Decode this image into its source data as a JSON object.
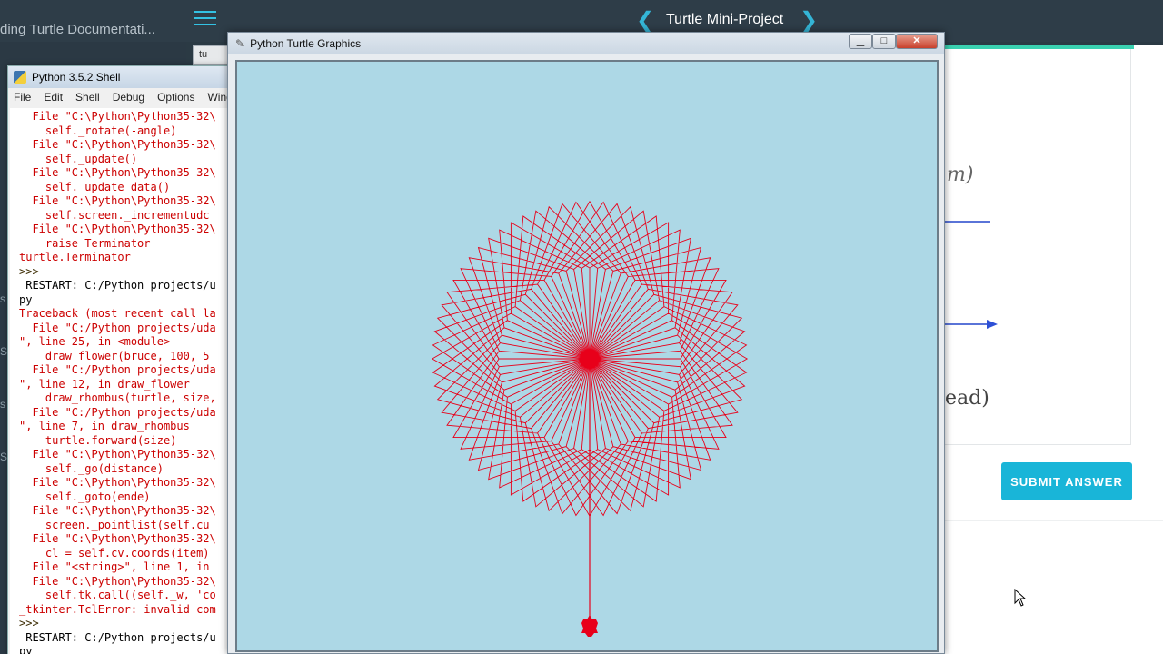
{
  "browser": {
    "left_tab_title": "ding Turtle Documentati...",
    "lesson_title": "Turtle Mini-Project",
    "submit_label": "SUBMIT ANSWER",
    "handwriting_1": "m)",
    "handwriting_2": "ead)",
    "left_edge_glyphs": [
      "s",
      "S",
      "s",
      "S"
    ]
  },
  "shell": {
    "behind_tab": "tu",
    "title": "Python 3.5.2 Shell",
    "menu": [
      "File",
      "Edit",
      "Shell",
      "Debug",
      "Options",
      "Wind"
    ],
    "lines": [
      {
        "t": "  File \"C:\\Python\\Python35-32\\",
        "k": "err"
      },
      {
        "t": "    self._rotate(-angle)",
        "k": "err"
      },
      {
        "t": "  File \"C:\\Python\\Python35-32\\",
        "k": "err"
      },
      {
        "t": "    self._update()",
        "k": "err"
      },
      {
        "t": "  File \"C:\\Python\\Python35-32\\",
        "k": "err"
      },
      {
        "t": "    self._update_data()",
        "k": "err"
      },
      {
        "t": "  File \"C:\\Python\\Python35-32\\",
        "k": "err"
      },
      {
        "t": "    self.screen._incrementudc",
        "k": "err"
      },
      {
        "t": "  File \"C:\\Python\\Python35-32\\",
        "k": "err"
      },
      {
        "t": "    raise Terminator",
        "k": "err"
      },
      {
        "t": "turtle.Terminator",
        "k": "err"
      },
      {
        "t": ">>> ",
        "k": "prompt"
      },
      {
        "t": " RESTART: C:/Python projects/u",
        "k": "out"
      },
      {
        "t": "py",
        "k": "out"
      },
      {
        "t": "Traceback (most recent call la",
        "k": "err"
      },
      {
        "t": "  File \"C:/Python projects/uda",
        "k": "err"
      },
      {
        "t": "\", line 25, in <module>",
        "k": "err"
      },
      {
        "t": "    draw_flower(bruce, 100, 5",
        "k": "err"
      },
      {
        "t": "  File \"C:/Python projects/uda",
        "k": "err"
      },
      {
        "t": "\", line 12, in draw_flower",
        "k": "err"
      },
      {
        "t": "    draw_rhombus(turtle, size,",
        "k": "err"
      },
      {
        "t": "  File \"C:/Python projects/uda",
        "k": "err"
      },
      {
        "t": "\", line 7, in draw_rhombus",
        "k": "err"
      },
      {
        "t": "    turtle.forward(size)",
        "k": "err"
      },
      {
        "t": "  File \"C:\\Python\\Python35-32\\",
        "k": "err"
      },
      {
        "t": "    self._go(distance)",
        "k": "err"
      },
      {
        "t": "  File \"C:\\Python\\Python35-32\\",
        "k": "err"
      },
      {
        "t": "    self._goto(ende)",
        "k": "err"
      },
      {
        "t": "  File \"C:\\Python\\Python35-32\\",
        "k": "err"
      },
      {
        "t": "    screen._pointlist(self.cu",
        "k": "err"
      },
      {
        "t": "  File \"C:\\Python\\Python35-32\\",
        "k": "err"
      },
      {
        "t": "    cl = self.cv.coords(item)",
        "k": "err"
      },
      {
        "t": "  File \"<string>\", line 1, in",
        "k": "err"
      },
      {
        "t": "  File \"C:\\Python\\Python35-32\\",
        "k": "err"
      },
      {
        "t": "    self.tk.call((self._w, 'co",
        "k": "err"
      },
      {
        "t": "_tkinter.TclError: invalid com",
        "k": "err"
      },
      {
        "t": ">>> ",
        "k": "prompt"
      },
      {
        "t": " RESTART: C:/Python projects/u",
        "k": "out"
      },
      {
        "t": "py",
        "k": "out"
      }
    ]
  },
  "turtle_window": {
    "title": "Python Turtle Graphics",
    "canvas_bg": "#add8e6",
    "pen_color": "#e8001a",
    "drawing": {
      "shape": "rhombus",
      "rhombus_count": 72,
      "rotation_step_deg": 5,
      "side_length": 100,
      "rhombus_angle_deg": 60
    }
  }
}
